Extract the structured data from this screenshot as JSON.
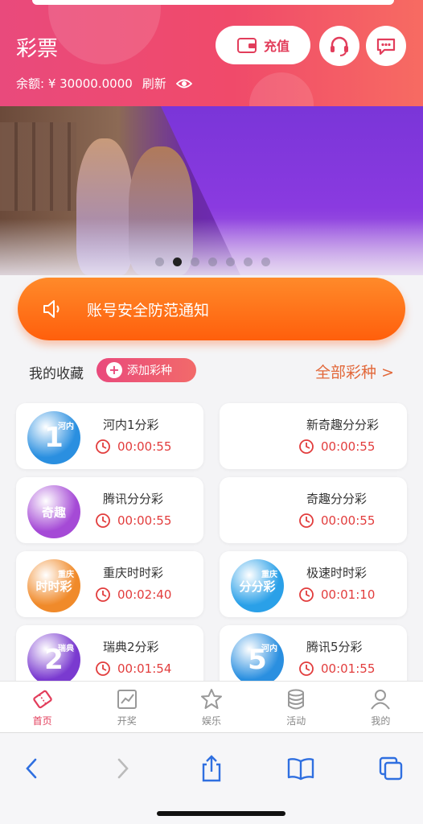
{
  "header": {
    "title": "彩票",
    "balance": "余额: ¥ 30000.0000",
    "refresh": "刷新",
    "recharge": "充值"
  },
  "banner": {
    "dots": 7,
    "active_dot": 2
  },
  "notice": {
    "text": "账号安全防范通知"
  },
  "favorites": {
    "label": "我的收藏",
    "add": "添加彩种",
    "all": "全部彩种 >"
  },
  "lotteries": [
    {
      "name": "河内1分彩",
      "time": "00:00:55",
      "logo_text": "1",
      "logo_sub": "河内",
      "logo_color": "#2a8fe0"
    },
    {
      "name": "新奇趣分分彩",
      "time": "00:00:55",
      "logo_text": "",
      "logo_sub": "",
      "logo_color": "#ffffff"
    },
    {
      "name": "腾讯分分彩",
      "time": "00:00:55",
      "logo_text": "奇趣",
      "logo_sub": "",
      "logo_color": "#a54ad6"
    },
    {
      "name": "奇趣分分彩",
      "time": "00:00:55",
      "logo_text": "",
      "logo_sub": "",
      "logo_color": "#ffffff"
    },
    {
      "name": "重庆时时彩",
      "time": "00:02:40",
      "logo_text": "时时彩",
      "logo_sub": "重庆",
      "logo_color": "#f08a2a"
    },
    {
      "name": "极速时时彩",
      "time": "00:01:10",
      "logo_text": "分分彩",
      "logo_sub": "重庆",
      "logo_color": "#2aa0e8"
    },
    {
      "name": "瑞典2分彩",
      "time": "00:01:54",
      "logo_text": "2",
      "logo_sub": "瑞典",
      "logo_color": "#7a3ad0"
    },
    {
      "name": "腾讯5分彩",
      "time": "00:01:55",
      "logo_text": "5",
      "logo_sub": "河内",
      "logo_color": "#2a8fe0"
    }
  ],
  "tabs": [
    {
      "label": "首页",
      "icon": "ticket-icon",
      "active": true
    },
    {
      "label": "开奖",
      "icon": "trend-chart-icon",
      "active": false
    },
    {
      "label": "娱乐",
      "icon": "star-icon",
      "active": false
    },
    {
      "label": "活动",
      "icon": "database-icon",
      "active": false
    },
    {
      "label": "我的",
      "icon": "user-icon",
      "active": false
    }
  ],
  "colors": {
    "accent": "#e23d5b",
    "orange": "#ff6a14",
    "time_red": "#e23d3d"
  }
}
